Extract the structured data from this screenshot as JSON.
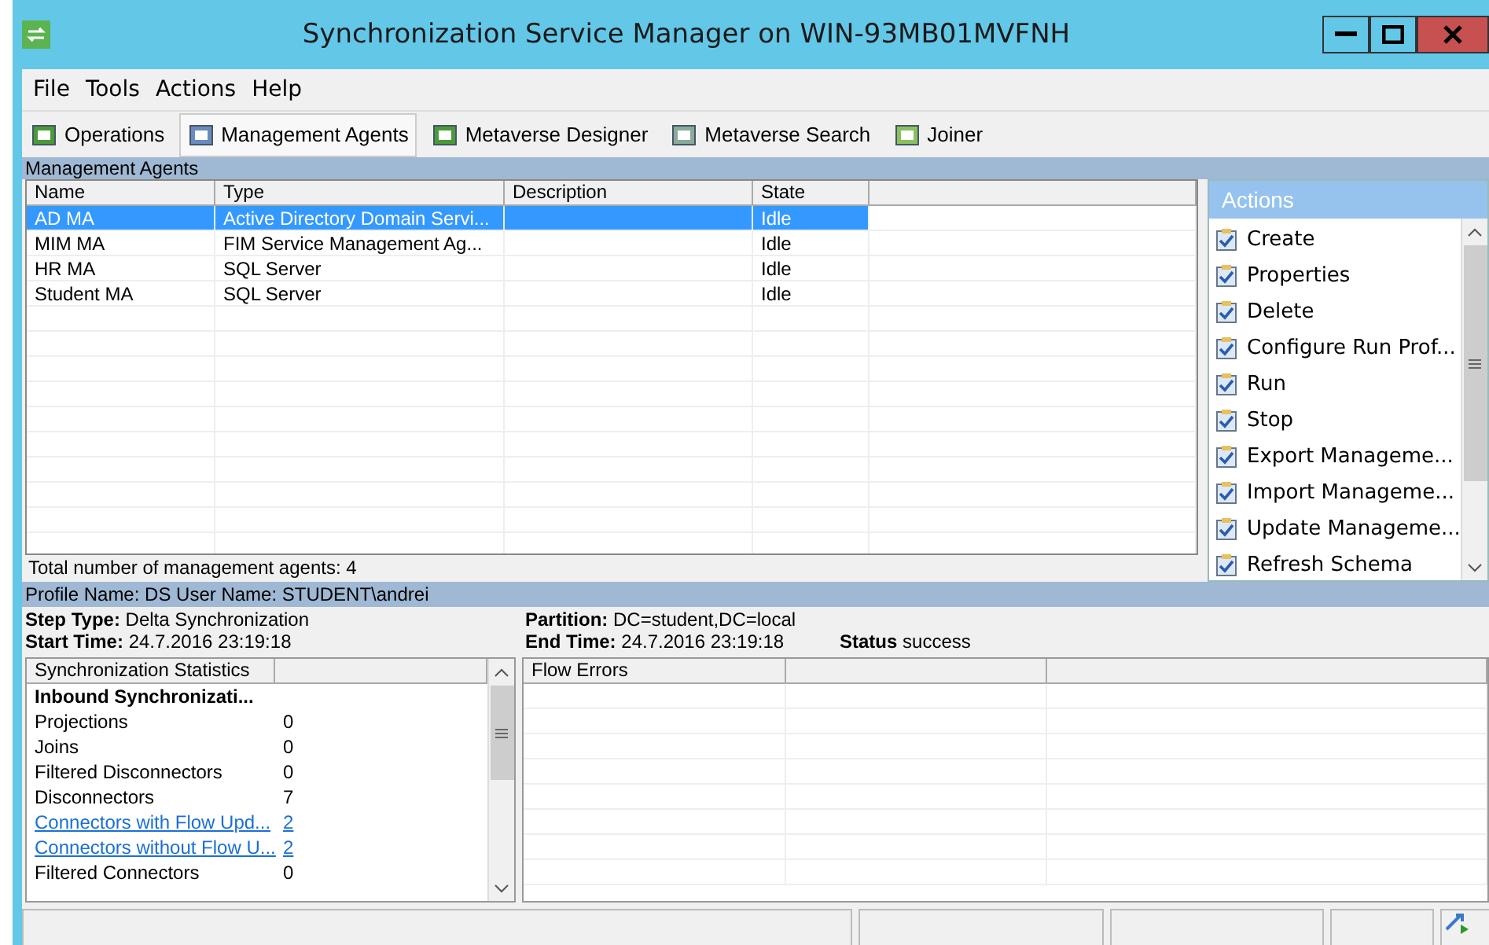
{
  "window": {
    "title": "Synchronization Service Manager on WIN-93MB01MVFNH"
  },
  "menu": [
    "File",
    "Tools",
    "Actions",
    "Help"
  ],
  "toolbar": [
    {
      "label": "Operations",
      "selected": false
    },
    {
      "label": "Management Agents",
      "selected": true
    },
    {
      "label": "Metaverse Designer",
      "selected": false
    },
    {
      "label": "Metaverse Search",
      "selected": false
    },
    {
      "label": "Joiner",
      "selected": false
    }
  ],
  "agents": {
    "title": "Management Agents",
    "columns": [
      "Name",
      "Type",
      "Description",
      "State"
    ],
    "rows": [
      {
        "cells": [
          "AD MA",
          "Active Directory Domain Servi...",
          "",
          "Idle"
        ],
        "selected": true
      },
      {
        "cells": [
          "MIM MA",
          "FIM Service Management Ag...",
          "",
          "Idle"
        ],
        "selected": false
      },
      {
        "cells": [
          "HR MA",
          "SQL Server",
          "",
          "Idle"
        ],
        "selected": false
      },
      {
        "cells": [
          "Student MA",
          "SQL Server",
          "",
          "Idle"
        ],
        "selected": false
      }
    ],
    "total": "Total number of management agents: 4"
  },
  "actions": {
    "title": "Actions",
    "items": [
      "Create",
      "Properties",
      "Delete",
      "Configure Run Prof...",
      "Run",
      "Stop",
      "Export Manageme...",
      "Import Manageme...",
      "Update Manageme...",
      "Refresh Schema"
    ]
  },
  "profile": {
    "header": "Profile Name: DS  User Name: STUDENT\\andrei",
    "step_type_label": "Step Type:",
    "step_type": "Delta Synchronization",
    "start_label": "Start Time:",
    "start": "24.7.2016 23:19:18",
    "partition_label": "Partition:",
    "partition": "DC=student,DC=local",
    "end_label": "End Time:",
    "end": "24.7.2016 23:19:18",
    "status_label": "Status",
    "status": "success"
  },
  "stats": {
    "title": "Synchronization Statistics",
    "rows": [
      {
        "kind": "heading",
        "label": "Inbound Synchronizati...",
        "value": ""
      },
      {
        "kind": "plain",
        "label": "Projections",
        "value": "0"
      },
      {
        "kind": "plain",
        "label": "Joins",
        "value": "0"
      },
      {
        "kind": "plain",
        "label": "Filtered Disconnectors",
        "value": "0"
      },
      {
        "kind": "plain",
        "label": "Disconnectors",
        "value": "7"
      },
      {
        "kind": "link",
        "label": "Connectors with Flow Upd...",
        "value": "2"
      },
      {
        "kind": "link",
        "label": "Connectors without Flow U...",
        "value": "2"
      },
      {
        "kind": "plain",
        "label": "Filtered Connectors",
        "value": "0"
      }
    ]
  },
  "flow_errors": {
    "title": "Flow Errors"
  }
}
